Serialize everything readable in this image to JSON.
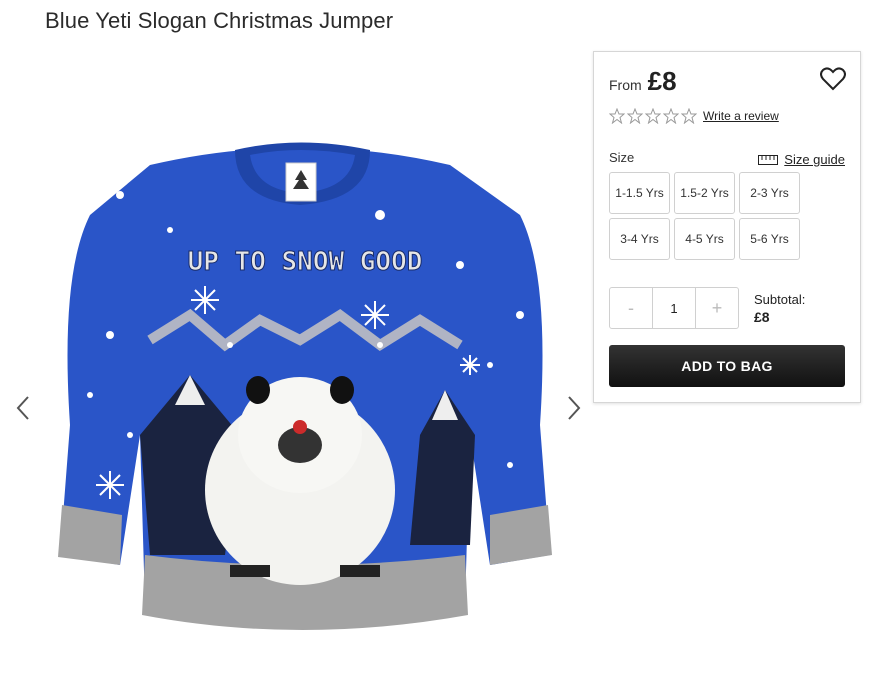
{
  "product": {
    "title": "Blue Yeti Slogan Christmas Jumper",
    "image_alt": "Blue Yeti Slogan Christmas Jumper",
    "sweater_slogan": "UP TO SNOW GOOD"
  },
  "panel": {
    "from_label": "From",
    "price": "£8",
    "rating": {
      "stars_filled": 0,
      "stars_total": 5
    },
    "write_review": "Write a review",
    "size_label": "Size",
    "size_guide": "Size guide",
    "sizes": [
      "1-1.5 Yrs",
      "1.5-2 Yrs",
      "2-3 Yrs",
      "3-4 Yrs",
      "4-5 Yrs",
      "5-6 Yrs"
    ],
    "quantity": {
      "minus": "-",
      "value": "1",
      "plus": "+"
    },
    "subtotal_label": "Subtotal:",
    "subtotal_value": "£8",
    "add_to_bag": "ADD TO BAG"
  },
  "colors": {
    "sweater_blue": "#2a55c8",
    "sweater_grey": "#9a9a9a",
    "add_button": "#1a1a1a"
  },
  "icons": [
    "heart-icon",
    "star-icon",
    "ruler-icon",
    "chevron-left-icon",
    "chevron-right-icon"
  ]
}
